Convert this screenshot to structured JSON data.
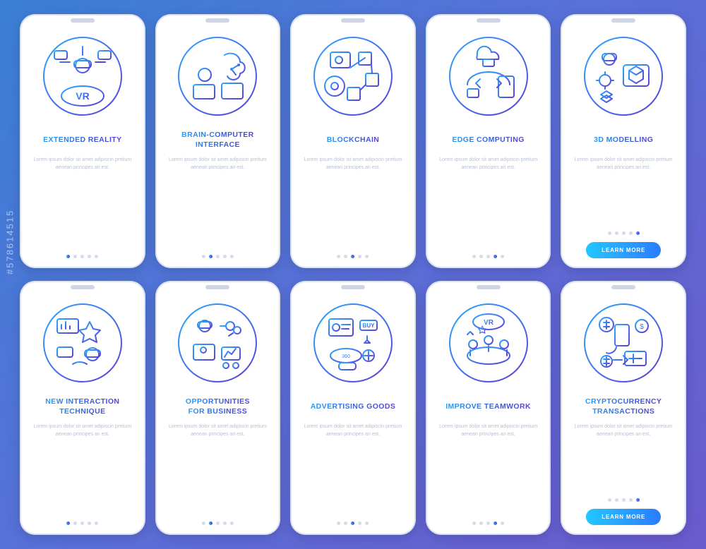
{
  "watermark": "#578614515",
  "lorem": "Lorem ipsum dolor sit amet adipiscin pretium aenean principes an est.",
  "cta_label": "LEARN MORE",
  "cards": [
    {
      "title": "EXTENDED REALITY",
      "icon": "vr",
      "active_dot": 0,
      "cta": false
    },
    {
      "title": "BRAIN-COMPUTER\nINTERFACE",
      "icon": "brain",
      "active_dot": 1,
      "cta": false
    },
    {
      "title": "BLOCKCHAIN",
      "icon": "blockchain",
      "active_dot": 2,
      "cta": false
    },
    {
      "title": "EDGE COMPUTING",
      "icon": "edge",
      "active_dot": 3,
      "cta": false
    },
    {
      "title": "3D MODELLING",
      "icon": "3d",
      "active_dot": 4,
      "cta": true
    },
    {
      "title": "NEW INTERACTION\nTECHNIQUE",
      "icon": "interact",
      "active_dot": 0,
      "cta": false
    },
    {
      "title": "OPPORTUNITIES\nFOR BUSINESS",
      "icon": "business",
      "active_dot": 1,
      "cta": false
    },
    {
      "title": "ADVERTISING GOODS",
      "icon": "ads",
      "active_dot": 2,
      "cta": false
    },
    {
      "title": "IMPROVE TEAMWORK",
      "icon": "team",
      "active_dot": 3,
      "cta": false
    },
    {
      "title": "CRYPTOCURRENCY\nTRANSACTIONS",
      "icon": "crypto",
      "active_dot": 4,
      "cta": true
    }
  ]
}
